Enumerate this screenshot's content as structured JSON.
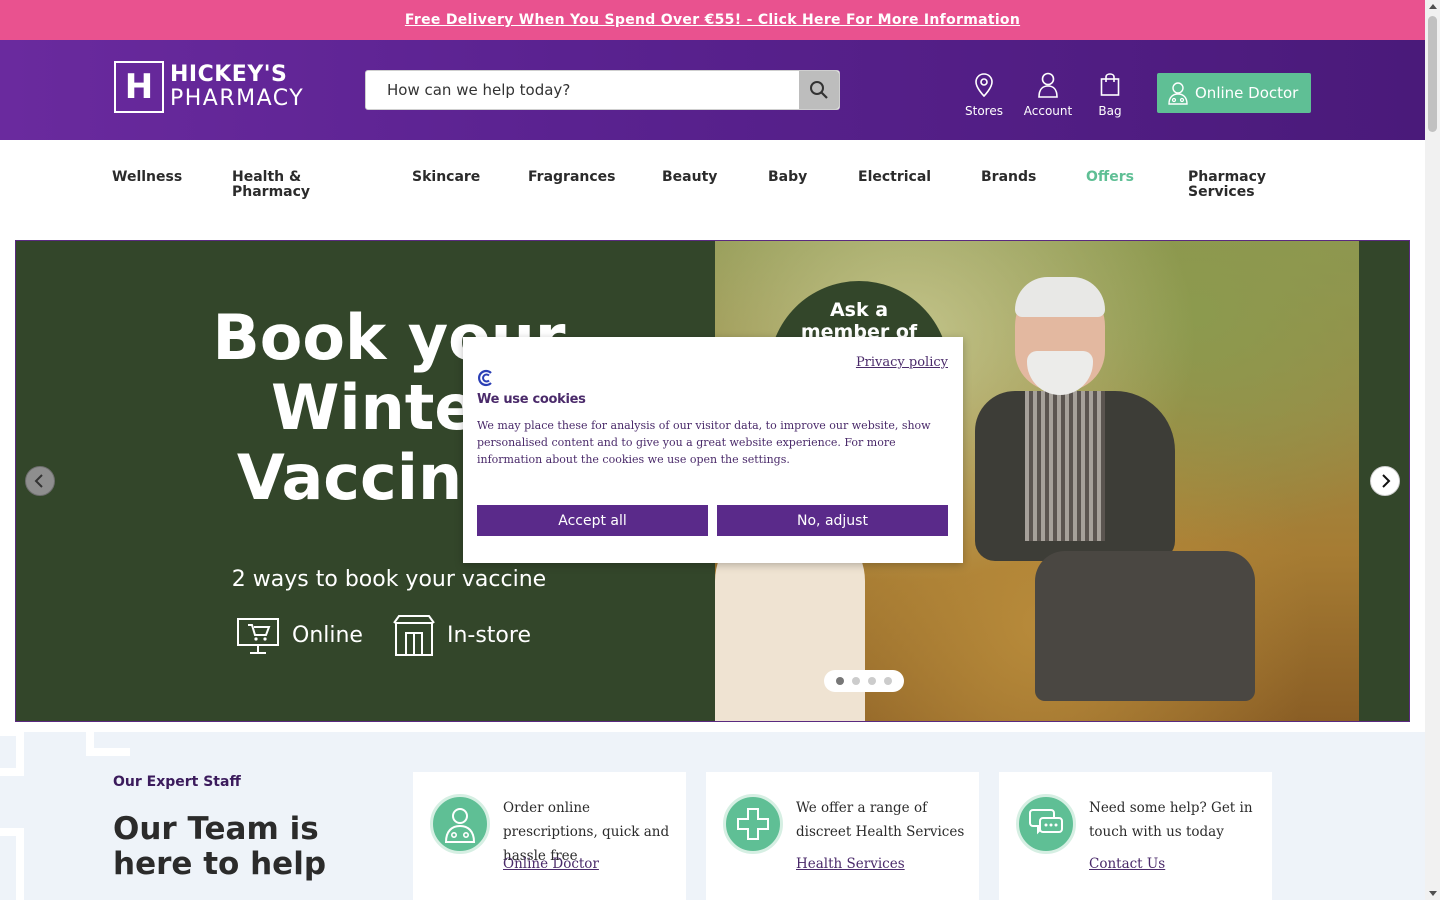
{
  "promo": {
    "text": "Free Delivery When You Spend Over €55! - Click Here For More Information"
  },
  "header": {
    "logo_line1": "HICKEY'S",
    "logo_line2": "PHARMACY",
    "logo_letter": "H",
    "search_placeholder": "How can we help today?",
    "icons": [
      {
        "label": "Stores",
        "icon": "location-pin-icon"
      },
      {
        "label": "Account",
        "icon": "user-icon"
      },
      {
        "label": "Bag",
        "icon": "shopping-bag-icon"
      }
    ],
    "online_doctor": "Online Doctor"
  },
  "nav": {
    "items": [
      {
        "label": "Wellness"
      },
      {
        "label": "Health &\nPharmacy"
      },
      {
        "label": "Skincare"
      },
      {
        "label": "Fragrances"
      },
      {
        "label": "Beauty"
      },
      {
        "label": "Baby"
      },
      {
        "label": "Electrical"
      },
      {
        "label": "Brands"
      },
      {
        "label": "Offers"
      },
      {
        "label": "Pharmacy\nServices"
      }
    ]
  },
  "hero": {
    "title": "Book your\nWinter\nVaccines",
    "subtitle": "2 ways to book your vaccine",
    "way_online": "Online",
    "way_instore": "In-store",
    "bubble": "Ask a\nmember of",
    "slides_total": 4,
    "slide_active": 1
  },
  "cookie": {
    "privacy_link": "Privacy policy",
    "title": "We use cookies",
    "body": "We may place these for analysis of our visitor data, to improve our website, show personalised content and to give you a great website experience. For more information about the cookies we use open the settings.",
    "accept": "Accept all",
    "adjust": "No, adjust"
  },
  "team": {
    "kicker": "Our Expert Staff",
    "title": "Our Team is here to help",
    "cards": [
      {
        "desc": "Order online prescriptions, quick and hassle free",
        "link": "Online Doctor",
        "icon": "doctor-icon"
      },
      {
        "desc": "We offer a range of discreet Health Services",
        "link": "Health Services",
        "icon": "medical-cross-icon"
      },
      {
        "desc": "Need some help? Get in touch with us today",
        "link": "Contact Us",
        "icon": "chat-icon"
      }
    ]
  },
  "colors": {
    "promo_bg": "#e9528f",
    "header_bg": "#5a2290",
    "accent_green": "#5fbf95",
    "hero_bg": "#33462a",
    "button_purple": "#5a2a8a"
  }
}
